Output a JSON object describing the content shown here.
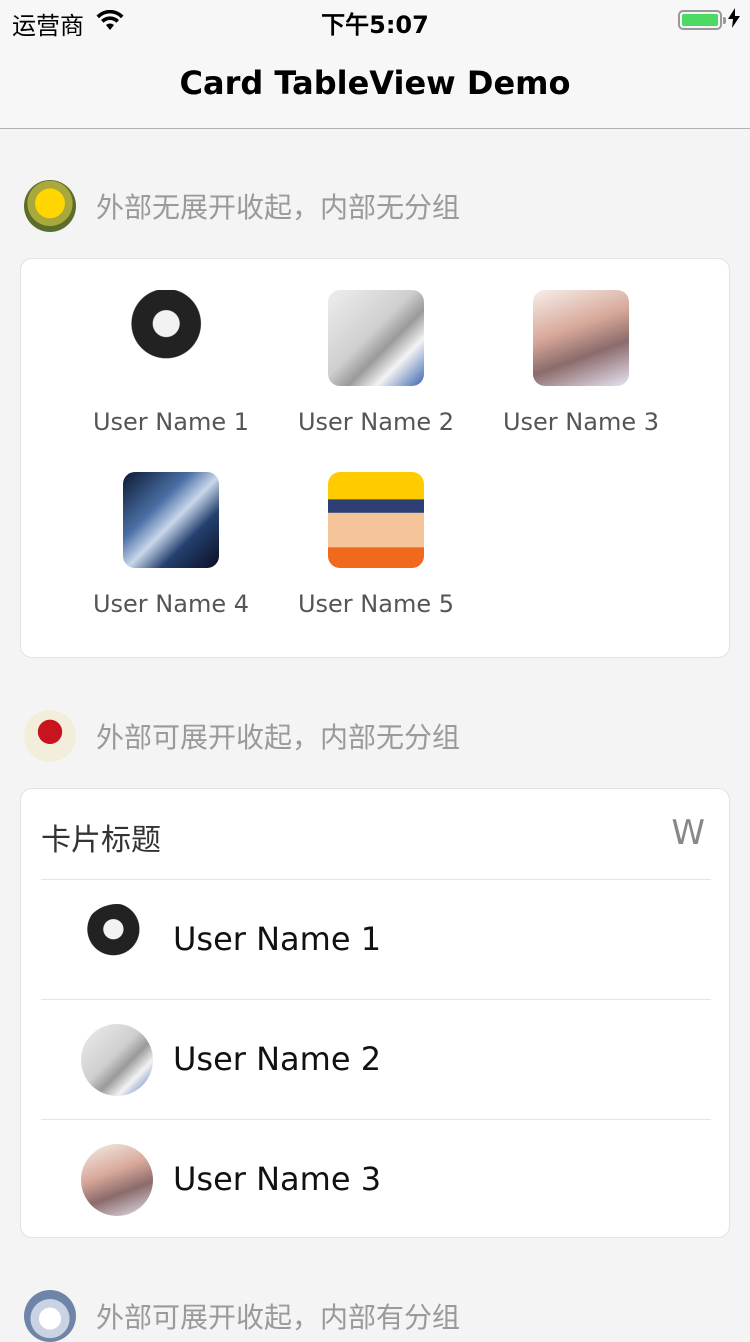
{
  "status_bar": {
    "carrier": "运营商",
    "time": "下午5:07",
    "battery_level": 1.0
  },
  "nav": {
    "title": "Card TableView Demo"
  },
  "sections": [
    {
      "title": "外部无展开收起，内部无分组",
      "icon": "dandelion-icon"
    },
    {
      "title": "外部可展开收起，内部无分组",
      "icon": "rose-icon"
    },
    {
      "title": "外部可展开收起，内部有分组",
      "icon": "white-flower-icon"
    }
  ],
  "grid_users": [
    {
      "name": "User Name 1"
    },
    {
      "name": "User Name 2"
    },
    {
      "name": "User Name 3"
    },
    {
      "name": "User Name 4"
    },
    {
      "name": "User Name 5"
    }
  ],
  "list_card": {
    "title": "卡片标题",
    "index_letter": "W",
    "rows": [
      {
        "name": "User Name 1"
      },
      {
        "name": "User Name 2"
      },
      {
        "name": "User Name 3"
      }
    ]
  }
}
